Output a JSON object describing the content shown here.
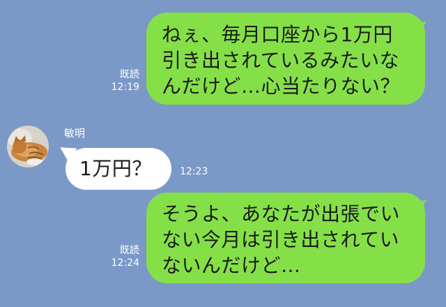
{
  "chat": {
    "background": "#7b99c7",
    "outgoing_bubble_color": "#85e048",
    "incoming_bubble_color": "#ffffff",
    "messages": [
      {
        "direction": "outgoing",
        "lines": [
          "ねぇ、毎月口座から1万円",
          "引き出されているみたいな",
          "んだけど…心当たりない？"
        ],
        "read_label": "既読",
        "time": "12:19"
      },
      {
        "direction": "incoming",
        "sender": "敏明",
        "avatar": "cat-photo-avatar",
        "lines": [
          "1万円？"
        ],
        "time": "12:23"
      },
      {
        "direction": "outgoing",
        "lines": [
          "そうよ、あなたが出張でい",
          "ない今月は引き出されてい",
          "ないんだけど…"
        ],
        "read_label": "既読",
        "time": "12:24"
      }
    ]
  }
}
